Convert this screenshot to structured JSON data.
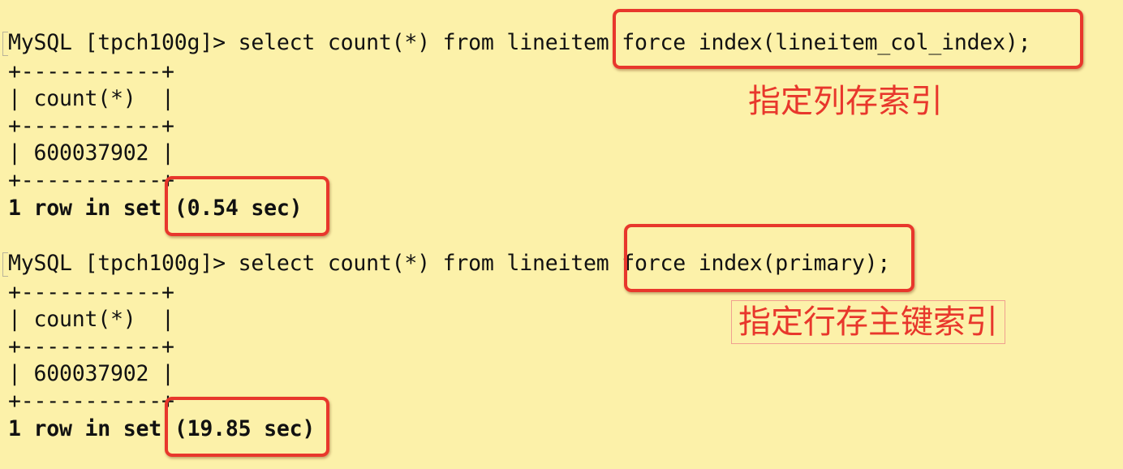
{
  "background_color": "#fcf1a9",
  "accent_color": "#e8372c",
  "queries": [
    {
      "prompt": "MySQL [tpch100g]> ",
      "sql_prefix": "select count(*) from lineitem",
      "sql_highlight": "force index(lineitem_col_index);",
      "table_border_top": "+-----------+",
      "table_header": "| count(*)  |",
      "table_border_mid": "+-----------+",
      "table_value": "| 600037902 |",
      "table_border_bottom": "+-----------+",
      "result_prefix": "1 row in set ",
      "result_time": "(0.54 sec)",
      "annotation": "指定列存索引"
    },
    {
      "prompt": "MySQL [tpch100g]> ",
      "sql_prefix": "select count(*) from lineitem",
      "sql_highlight": "force index(primary);",
      "table_border_top": "+-----------+",
      "table_header": "| count(*)  |",
      "table_border_mid": "+-----------+",
      "table_value": "| 600037902 |",
      "table_border_bottom": "+-----------+",
      "result_prefix": "1 row in set ",
      "result_time": "(19.85 sec)",
      "annotation": "指定行存主键索引"
    }
  ]
}
